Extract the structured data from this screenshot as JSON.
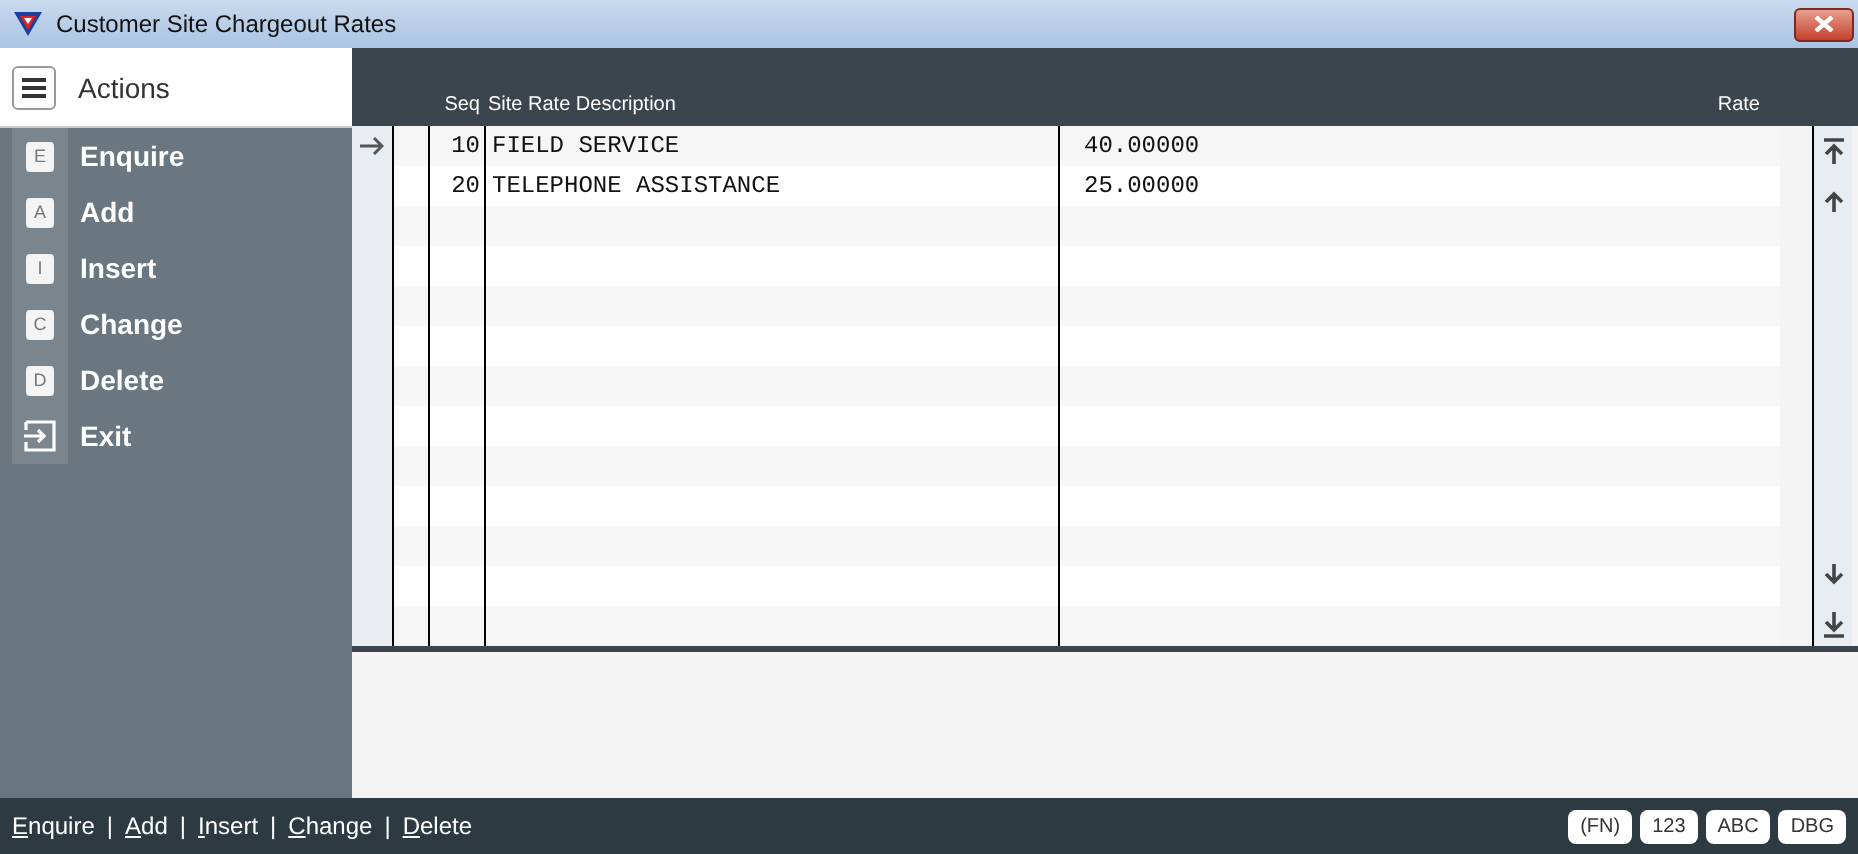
{
  "window": {
    "title": "Customer Site Chargeout Rates"
  },
  "sidebar": {
    "title": "Actions",
    "items": [
      {
        "key": "E",
        "label": "Enquire",
        "kind": "letter"
      },
      {
        "key": "A",
        "label": "Add",
        "kind": "letter"
      },
      {
        "key": "I",
        "label": "Insert",
        "kind": "letter"
      },
      {
        "key": "C",
        "label": "Change",
        "kind": "letter"
      },
      {
        "key": "D",
        "label": "Delete",
        "kind": "letter"
      },
      {
        "label": "Exit",
        "kind": "exit"
      }
    ]
  },
  "table": {
    "columns": [
      "Seq",
      "Site Rate Description",
      "Rate"
    ],
    "rows": [
      {
        "seq": "10",
        "description": "FIELD SERVICE",
        "rate": "40.00000",
        "selected": true
      },
      {
        "seq": "20",
        "description": "TELEPHONE ASSISTANCE",
        "rate": "25.00000",
        "selected": false
      }
    ]
  },
  "status_bar": {
    "separator": "|",
    "links": [
      "Enquire",
      "Add",
      "Insert",
      "Change",
      "Delete"
    ],
    "badges": [
      "(FN)",
      "123",
      "ABC",
      "DBG"
    ]
  }
}
